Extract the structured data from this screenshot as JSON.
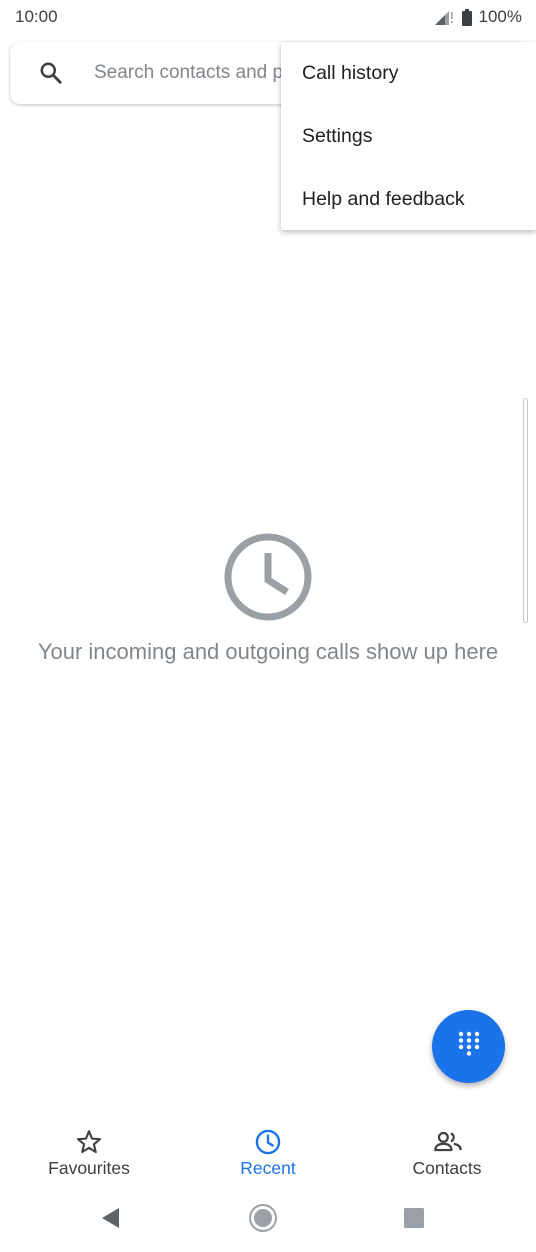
{
  "status_bar": {
    "time": "10:00",
    "battery": "100%",
    "icons": [
      "signal-icon",
      "battery-icon"
    ]
  },
  "search": {
    "placeholder": "Search contacts and places",
    "icon": "search-icon"
  },
  "overflow_menu": {
    "items": [
      {
        "label": "Call history"
      },
      {
        "label": "Settings"
      },
      {
        "label": "Help and feedback"
      }
    ]
  },
  "empty_state": {
    "icon": "clock-icon",
    "message": "Your incoming and outgoing calls show up here"
  },
  "fab": {
    "icon": "dialpad-icon"
  },
  "bottom_nav": {
    "tabs": [
      {
        "label": "Favourites",
        "icon": "star-icon",
        "active": false
      },
      {
        "label": "Recent",
        "icon": "clock-icon",
        "active": true
      },
      {
        "label": "Contacts",
        "icon": "people-icon",
        "active": false
      }
    ]
  },
  "system_nav": {
    "buttons": [
      "back-icon",
      "home-icon",
      "recents-icon"
    ]
  },
  "colors": {
    "accent": "#1a73e8",
    "text_primary": "#202124",
    "text_secondary": "#80868b",
    "icon_gray": "#9aa0a6"
  }
}
